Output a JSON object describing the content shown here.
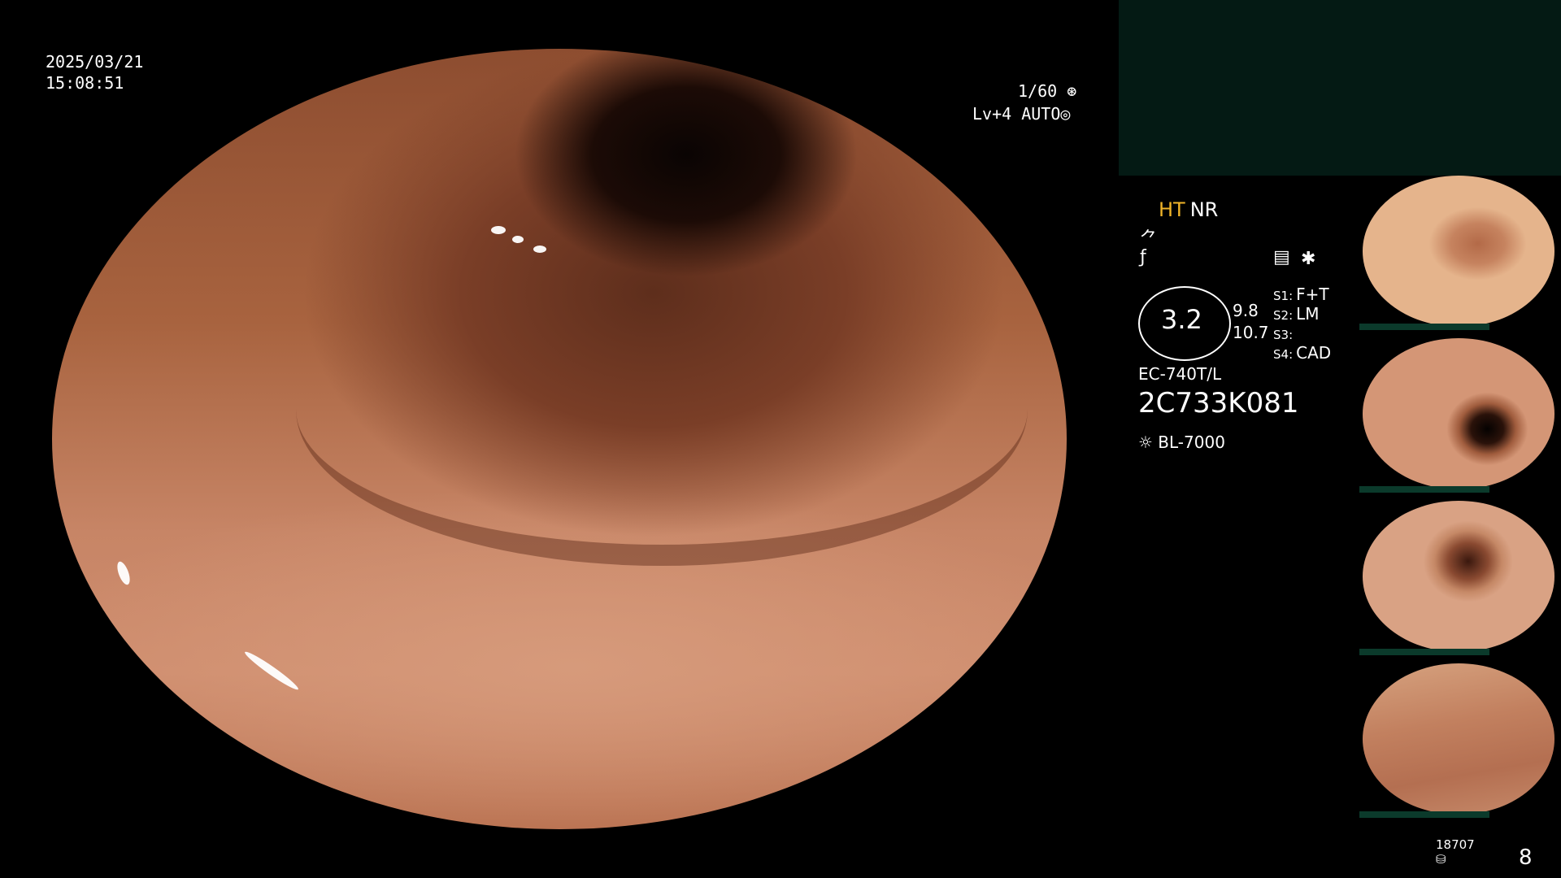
{
  "overlay": {
    "date": "2025/03/21",
    "time": "15:08:51",
    "shutter": "1/60",
    "level": "Lv+4",
    "exposure": "AUTO"
  },
  "info_panel": {
    "ht": "HT",
    "nr": "NR",
    "zoom": "3.2",
    "zoom_left": "9.8",
    "zoom_right": "10.7",
    "switches": [
      {
        "key": "S1:",
        "value": "F+T"
      },
      {
        "key": "S2:",
        "value": "LM"
      },
      {
        "key": "S3:",
        "value": ""
      },
      {
        "key": "S4:",
        "value": "CAD"
      }
    ],
    "scope_model": "EC-740T/L",
    "scope_serial": "2C733K081",
    "light_source": "BL-7000"
  },
  "footer": {
    "count": "18707",
    "number": "8"
  }
}
